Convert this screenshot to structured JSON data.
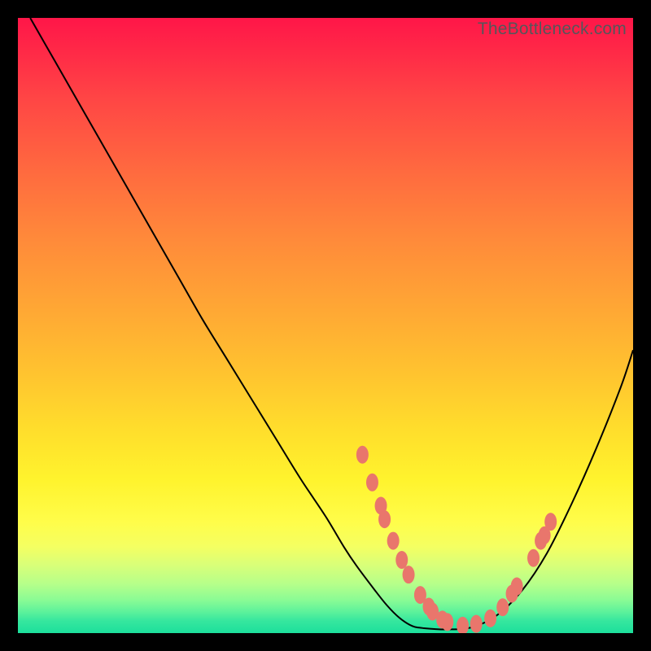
{
  "watermark": "TheBottleneck.com",
  "colors": {
    "frame": "#000000",
    "gradient_top": "#ff1648",
    "gradient_mid1": "#ff8a3a",
    "gradient_mid2": "#ffde2c",
    "gradient_mid3": "#fff32d",
    "gradient_bottom": "#1cdf9c",
    "curve": "#000000",
    "dots": "#e9766c"
  },
  "chart_data": {
    "type": "line",
    "title": "",
    "xlabel": "",
    "ylabel": "",
    "xlim": [
      0,
      100
    ],
    "ylim": [
      0,
      100
    ],
    "grid": false,
    "legend": false,
    "series": [
      {
        "name": "bottleneck-curve",
        "x": [
          2,
          6,
          10,
          14,
          18,
          22,
          26,
          30,
          34,
          38,
          42,
          46,
          50,
          53,
          55,
          58,
          60,
          62,
          64,
          66,
          70,
          74,
          78,
          82,
          86,
          90,
          94,
          98,
          100
        ],
        "y": [
          100,
          93,
          86,
          79,
          72,
          65,
          58,
          51,
          44.5,
          38,
          31.5,
          25,
          19,
          14,
          11,
          7,
          4.5,
          2.5,
          1.2,
          0.8,
          0.6,
          1.0,
          3,
          7,
          13,
          21,
          30,
          40,
          46
        ]
      }
    ],
    "highlight_points": {
      "name": "near-minimum-dots",
      "points": [
        {
          "x": 56.0,
          "y": 29.0
        },
        {
          "x": 57.6,
          "y": 24.5
        },
        {
          "x": 59.0,
          "y": 20.7
        },
        {
          "x": 59.6,
          "y": 18.5
        },
        {
          "x": 61.0,
          "y": 15.0
        },
        {
          "x": 62.4,
          "y": 11.9
        },
        {
          "x": 63.5,
          "y": 9.5
        },
        {
          "x": 65.4,
          "y": 6.2
        },
        {
          "x": 66.8,
          "y": 4.3
        },
        {
          "x": 67.4,
          "y": 3.5
        },
        {
          "x": 69.0,
          "y": 2.2
        },
        {
          "x": 69.8,
          "y": 1.8
        },
        {
          "x": 72.3,
          "y": 1.2
        },
        {
          "x": 74.5,
          "y": 1.5
        },
        {
          "x": 76.8,
          "y": 2.4
        },
        {
          "x": 78.8,
          "y": 4.2
        },
        {
          "x": 80.3,
          "y": 6.4
        },
        {
          "x": 81.1,
          "y": 7.6
        },
        {
          "x": 83.8,
          "y": 12.2
        },
        {
          "x": 85.0,
          "y": 15.0
        },
        {
          "x": 85.6,
          "y": 15.9
        },
        {
          "x": 86.6,
          "y": 18.1
        }
      ]
    }
  }
}
